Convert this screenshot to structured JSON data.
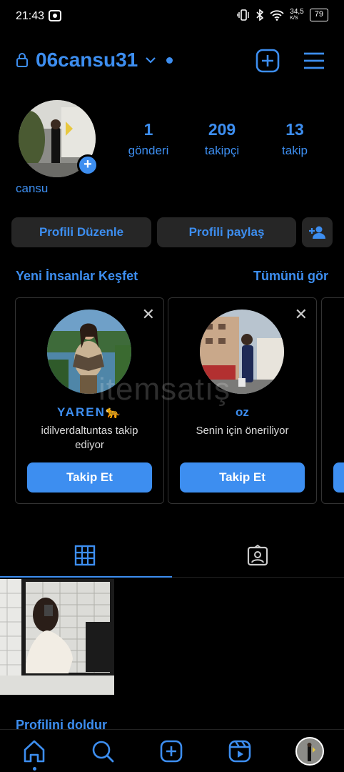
{
  "status_bar": {
    "time": "21:43",
    "network_speed": "34,5",
    "network_unit": "K/S",
    "battery": "79"
  },
  "header": {
    "username": "06cansu31",
    "icons": [
      "lock-icon",
      "chevron-down-icon",
      "add-post-icon",
      "menu-icon"
    ]
  },
  "profile": {
    "display_name": "cansu",
    "stats": [
      {
        "value": "1",
        "label": "gönderi"
      },
      {
        "value": "209",
        "label": "takipçi"
      },
      {
        "value": "13",
        "label": "takip"
      }
    ],
    "edit_button": "Profili Düzenle",
    "share_button": "Profili paylaş"
  },
  "discover": {
    "title": "Yeni İnsanlar Keşfet",
    "see_all": "Tümünü gör",
    "cards": [
      {
        "name": "YAREN🐆",
        "subtitle": "idilverdaltuntas takip ediyor",
        "button": "Takip Et"
      },
      {
        "name": "oz",
        "subtitle": "Senin için öneriliyor",
        "button": "Takip Et"
      }
    ]
  },
  "watermark": "itemsatış",
  "tabs": [
    "grid-icon",
    "tagged-icon"
  ],
  "fill_profile": {
    "title": "Profilini doldur"
  },
  "bottom_nav": [
    "home-icon",
    "search-icon",
    "create-icon",
    "reels-icon",
    "profile-avatar"
  ],
  "colors": {
    "accent": "#3d8ef0",
    "background": "#000000",
    "button_bg": "#262626"
  }
}
